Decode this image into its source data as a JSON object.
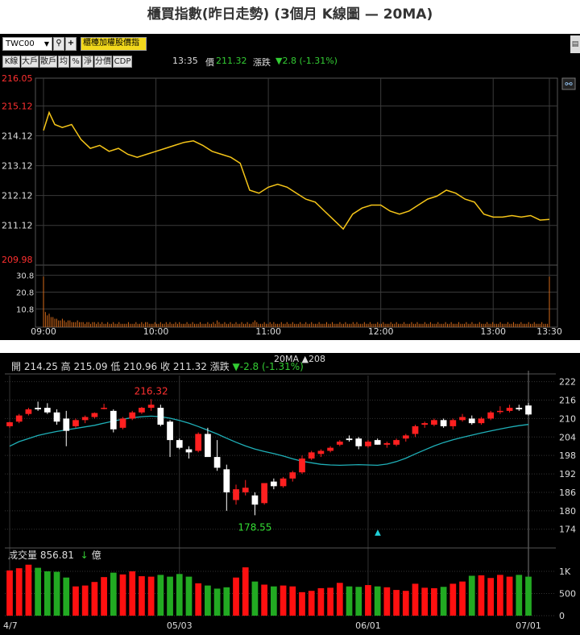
{
  "page_title": "櫃買指數(昨日走勢) (3個月 K線圖 — 20MA)",
  "intraday": {
    "symbol": "TWC00",
    "market_button": "櫃檯加權股價指",
    "tabs": [
      "K線",
      "大戶",
      "散戶",
      "均",
      "%",
      "淨",
      "分價",
      "CDP"
    ],
    "time": "13:35",
    "price_label": "價",
    "price": "211.32",
    "change_label": "漲跌",
    "change": "▼2.8 (-1.31%)",
    "link_icon": "link-icon",
    "colors": {
      "price_line": "#f5c518",
      "volume": "#d46a1a",
      "up": "#ff3030",
      "down": "#33cc33",
      "grid": "#3a3a3a"
    }
  },
  "daily": {
    "info": {
      "open_label": "開",
      "open": "214.25",
      "high_label": "高",
      "high": "215.09",
      "low_label": "低",
      "low": "210.96",
      "close_label": "收",
      "close": "211.32",
      "change_label": "漲跌",
      "change": "▼-2.8 (-1.31%)",
      "ma_label": "20MA ▲208"
    },
    "max_label": "216.32",
    "min_label": "178.55",
    "volume_label": "成交量",
    "volume_value": "856.81",
    "volume_arrow": "↓",
    "volume_unit": "億",
    "colors": {
      "up": "#ff2020",
      "down": "#ffffff",
      "ma": "#1fb0b8",
      "vol_up": "#ff1010",
      "vol_down": "#22aa22",
      "grid": "#333333"
    }
  },
  "chart_data": [
    {
      "type": "line",
      "title": "",
      "x_ticks": [
        "09:00",
        "10:00",
        "11:00",
        "12:00",
        "13:00",
        "13:30"
      ],
      "y_ticks": [
        "216.05",
        "215.12",
        "214.12",
        "213.12",
        "212.12",
        "211.12",
        "209.98"
      ],
      "ylim": [
        209.98,
        216.05
      ],
      "grid": true,
      "series": [
        {
          "x": [
            "09:00",
            "09:03",
            "09:06",
            "09:10",
            "09:15",
            "09:20",
            "09:25",
            "09:30",
            "09:35",
            "09:40",
            "09:45",
            "09:50",
            "09:55",
            "10:00",
            "10:05",
            "10:10",
            "10:15",
            "10:20",
            "10:25",
            "10:30",
            "10:35",
            "10:40",
            "10:45",
            "10:50",
            "10:55",
            "11:00",
            "11:05",
            "11:10",
            "11:15",
            "11:20",
            "11:25",
            "11:30",
            "11:35",
            "11:40",
            "11:45",
            "11:50",
            "11:55",
            "12:00",
            "12:05",
            "12:10",
            "12:15",
            "12:20",
            "12:25",
            "12:30",
            "12:35",
            "12:40",
            "12:45",
            "12:50",
            "12:55",
            "13:00",
            "13:05",
            "13:10",
            "13:15",
            "13:20",
            "13:25",
            "13:30"
          ],
          "values": [
            214.3,
            214.9,
            214.5,
            214.4,
            214.5,
            214.0,
            213.7,
            213.8,
            213.6,
            213.7,
            213.5,
            213.4,
            213.5,
            213.6,
            213.7,
            213.8,
            213.9,
            213.95,
            213.8,
            213.6,
            213.5,
            213.4,
            213.2,
            212.3,
            212.2,
            212.4,
            212.5,
            212.4,
            212.2,
            212.0,
            211.9,
            211.6,
            211.3,
            211.0,
            211.5,
            211.7,
            211.8,
            211.8,
            211.6,
            211.5,
            211.6,
            211.8,
            212.0,
            212.1,
            212.3,
            212.2,
            212.0,
            211.9,
            211.5,
            211.4,
            211.4,
            211.45,
            211.4,
            211.45,
            211.3,
            211.32
          ]
        }
      ],
      "volume": {
        "y_ticks": [
          "30.8",
          "20.8",
          "10.8"
        ],
        "values": [
          30,
          9,
          7,
          8,
          6,
          6,
          5,
          5,
          4,
          4,
          5,
          4,
          3,
          4,
          4,
          3,
          3,
          3,
          4,
          3,
          3,
          3,
          2,
          3,
          3,
          2,
          3,
          3,
          2,
          3,
          2,
          3,
          2,
          2,
          3,
          2,
          2,
          3,
          2,
          2,
          3,
          2,
          2,
          2,
          2,
          3,
          2,
          2,
          2,
          3,
          2,
          2,
          3,
          2,
          3,
          3,
          2,
          2,
          2,
          3,
          2,
          2,
          3,
          2,
          2,
          3,
          2,
          3,
          2,
          2,
          3,
          2,
          3,
          2,
          2,
          2,
          3,
          2,
          2,
          3,
          2,
          2,
          2,
          3,
          2,
          2,
          2,
          3,
          2,
          2,
          3,
          2,
          4,
          3,
          2,
          2,
          3,
          2,
          2,
          3,
          2,
          2,
          3,
          2,
          2,
          3,
          2,
          2,
          3,
          2,
          2,
          3,
          4,
          3,
          2,
          2,
          2,
          3,
          2,
          2,
          3,
          2,
          3,
          2,
          2,
          2,
          3,
          2,
          2,
          3,
          2,
          2,
          3,
          2,
          2,
          2,
          3,
          2,
          2,
          3,
          2,
          2,
          3,
          2,
          2,
          2,
          3,
          2,
          2,
          2,
          3,
          2,
          2,
          3,
          2,
          2,
          2,
          3,
          2,
          2,
          3,
          2,
          2,
          2,
          3,
          2,
          3,
          2,
          2,
          2,
          3,
          2,
          2,
          3,
          2,
          2,
          2,
          3,
          2,
          2,
          3,
          2,
          2,
          2,
          3,
          2,
          2,
          3,
          2,
          2,
          2,
          3,
          2,
          2,
          2,
          3,
          2,
          2,
          3,
          2,
          2,
          2,
          3,
          2,
          2,
          3,
          2,
          2,
          2,
          3,
          2,
          2,
          2,
          3,
          2,
          2,
          3,
          2,
          2,
          2,
          3,
          2,
          2,
          2,
          3,
          2,
          2,
          3,
          2,
          2,
          2,
          3,
          2,
          2,
          2,
          3,
          2,
          2,
          3,
          2,
          2,
          2,
          3,
          2,
          2,
          2,
          3,
          2,
          2,
          3,
          2,
          2,
          2,
          3,
          2,
          2,
          2,
          3,
          2,
          2,
          3,
          2,
          2,
          2,
          3,
          2,
          2,
          2,
          30
        ]
      }
    },
    {
      "type": "bar",
      "title": "",
      "x_ticks": [
        "4/7",
        "05/03",
        "06/01",
        "07/01"
      ],
      "y_ticks": [
        "222",
        "216",
        "210",
        "204",
        "198",
        "192",
        "186",
        "180",
        "174"
      ],
      "ylim": [
        170,
        224
      ],
      "candles": [
        {
          "o": 207.5,
          "h": 209,
          "l": 207,
          "c": 208.8
        },
        {
          "o": 209,
          "h": 211.5,
          "l": 208.5,
          "c": 211
        },
        {
          "o": 211.5,
          "h": 213.5,
          "l": 211,
          "c": 213
        },
        {
          "o": 213.5,
          "h": 215.5,
          "l": 212.5,
          "c": 213
        },
        {
          "o": 213.5,
          "h": 215,
          "l": 211.5,
          "c": 212
        },
        {
          "o": 212,
          "h": 213,
          "l": 208,
          "c": 209
        },
        {
          "o": 210,
          "h": 212.5,
          "l": 201,
          "c": 206
        },
        {
          "o": 207.5,
          "h": 210,
          "l": 207,
          "c": 209.5
        },
        {
          "o": 209.5,
          "h": 211,
          "l": 208.5,
          "c": 210.5
        },
        {
          "o": 210.5,
          "h": 212,
          "l": 210,
          "c": 211.8
        },
        {
          "o": 213.5,
          "h": 214.8,
          "l": 213,
          "c": 213.5
        },
        {
          "o": 212.5,
          "h": 213,
          "l": 205.5,
          "c": 206.5
        },
        {
          "o": 207,
          "h": 210.5,
          "l": 206.5,
          "c": 210
        },
        {
          "o": 210,
          "h": 212.5,
          "l": 209.5,
          "c": 212
        },
        {
          "o": 212,
          "h": 213.8,
          "l": 211.5,
          "c": 213.5
        },
        {
          "o": 213.5,
          "h": 216.32,
          "l": 212.5,
          "c": 214.5
        },
        {
          "o": 213.5,
          "h": 214.5,
          "l": 207.5,
          "c": 208
        },
        {
          "o": 209,
          "h": 209.5,
          "l": 197.5,
          "c": 203
        },
        {
          "o": 203,
          "h": 203.5,
          "l": 200,
          "c": 200.5
        },
        {
          "o": 200,
          "h": 201,
          "l": 197,
          "c": 199
        },
        {
          "o": 199.5,
          "h": 205.5,
          "l": 199,
          "c": 205
        },
        {
          "o": 205,
          "h": 207,
          "l": 198.5,
          "c": 197.5
        },
        {
          "o": 197.5,
          "h": 203,
          "l": 193,
          "c": 194
        },
        {
          "o": 193.5,
          "h": 195,
          "l": 180,
          "c": 186
        },
        {
          "o": 183.5,
          "h": 188.5,
          "l": 182,
          "c": 187
        },
        {
          "o": 186,
          "h": 190,
          "l": 185,
          "c": 187.5
        },
        {
          "o": 185,
          "h": 186,
          "l": 178.55,
          "c": 182
        },
        {
          "o": 182.5,
          "h": 189,
          "l": 182,
          "c": 189
        },
        {
          "o": 189.5,
          "h": 190.5,
          "l": 187,
          "c": 188
        },
        {
          "o": 188,
          "h": 191,
          "l": 187.5,
          "c": 190.5
        },
        {
          "o": 190.5,
          "h": 193,
          "l": 189.5,
          "c": 192.5
        },
        {
          "o": 192.5,
          "h": 198,
          "l": 192,
          "c": 197
        },
        {
          "o": 197,
          "h": 199.5,
          "l": 196.5,
          "c": 199
        },
        {
          "o": 198.5,
          "h": 200,
          "l": 197.5,
          "c": 199.5
        },
        {
          "o": 199.5,
          "h": 201,
          "l": 199,
          "c": 200.5
        },
        {
          "o": 201.5,
          "h": 203,
          "l": 201,
          "c": 202.5
        },
        {
          "o": 203.5,
          "h": 204.5,
          "l": 202.5,
          "c": 203
        },
        {
          "o": 203.5,
          "h": 204,
          "l": 200,
          "c": 201
        },
        {
          "o": 201,
          "h": 203,
          "l": 200.5,
          "c": 202.5
        },
        {
          "o": 203,
          "h": 203.5,
          "l": 201.5,
          "c": 201.5
        },
        {
          "o": 201.5,
          "h": 202.5,
          "l": 200.5,
          "c": 202
        },
        {
          "o": 201.5,
          "h": 203.5,
          "l": 201,
          "c": 203
        },
        {
          "o": 203.5,
          "h": 205,
          "l": 202.5,
          "c": 204.5
        },
        {
          "o": 205,
          "h": 208,
          "l": 204,
          "c": 207.5
        },
        {
          "o": 208,
          "h": 209,
          "l": 207,
          "c": 208.5
        },
        {
          "o": 208,
          "h": 210,
          "l": 207.5,
          "c": 209.5
        },
        {
          "o": 209.5,
          "h": 210,
          "l": 207,
          "c": 207.5
        },
        {
          "o": 207.5,
          "h": 210,
          "l": 206.5,
          "c": 209.5
        },
        {
          "o": 209.5,
          "h": 211.5,
          "l": 209,
          "c": 210.5
        },
        {
          "o": 210,
          "h": 211,
          "l": 208,
          "c": 208.5
        },
        {
          "o": 208.5,
          "h": 210.5,
          "l": 208,
          "c": 210
        },
        {
          "o": 210,
          "h": 212.5,
          "l": 209.5,
          "c": 212
        },
        {
          "o": 212.5,
          "h": 214,
          "l": 211.5,
          "c": 212.5
        },
        {
          "o": 212.5,
          "h": 214.5,
          "l": 212,
          "c": 213.5
        },
        {
          "o": 213.5,
          "h": 214.5,
          "l": 212.5,
          "c": 213
        },
        {
          "o": 214.25,
          "h": 215.09,
          "l": 210.96,
          "c": 211.32
        }
      ],
      "ma20": [
        201,
        202.5,
        203.5,
        204.5,
        205.2,
        205.8,
        206.3,
        206.8,
        207.3,
        207.8,
        208.5,
        209.2,
        209.8,
        210.3,
        210.6,
        210.8,
        210.6,
        210.1,
        209.4,
        208.5,
        207.4,
        206.2,
        205,
        203.6,
        202.3,
        201.1,
        200.1,
        199.3,
        198.6,
        197.8,
        196.9,
        196.1,
        195.6,
        195.1,
        194.9,
        194.8,
        194.9,
        195.0,
        194.9,
        194.8,
        195.2,
        196,
        197.1,
        198.5,
        199.8,
        201.1,
        202.2,
        203.1,
        203.9,
        204.6,
        205.3,
        206,
        206.6,
        207.2,
        207.7,
        208.1
      ],
      "volume": {
        "y_ticks": [
          "1K",
          "500",
          "0"
        ],
        "max": 1200,
        "values": [
          1020,
          1070,
          1150,
          1080,
          1000,
          990,
          860,
          660,
          680,
          760,
          870,
          970,
          930,
          1000,
          890,
          880,
          920,
          880,
          940,
          880,
          730,
          680,
          610,
          640,
          860,
          1090,
          770,
          700,
          660,
          680,
          660,
          530,
          560,
          620,
          630,
          740,
          660,
          650,
          690,
          660,
          640,
          580,
          560,
          720,
          630,
          620,
          650,
          720,
          770,
          900,
          910,
          850,
          920,
          880,
          920,
          880
        ]
      }
    }
  ]
}
